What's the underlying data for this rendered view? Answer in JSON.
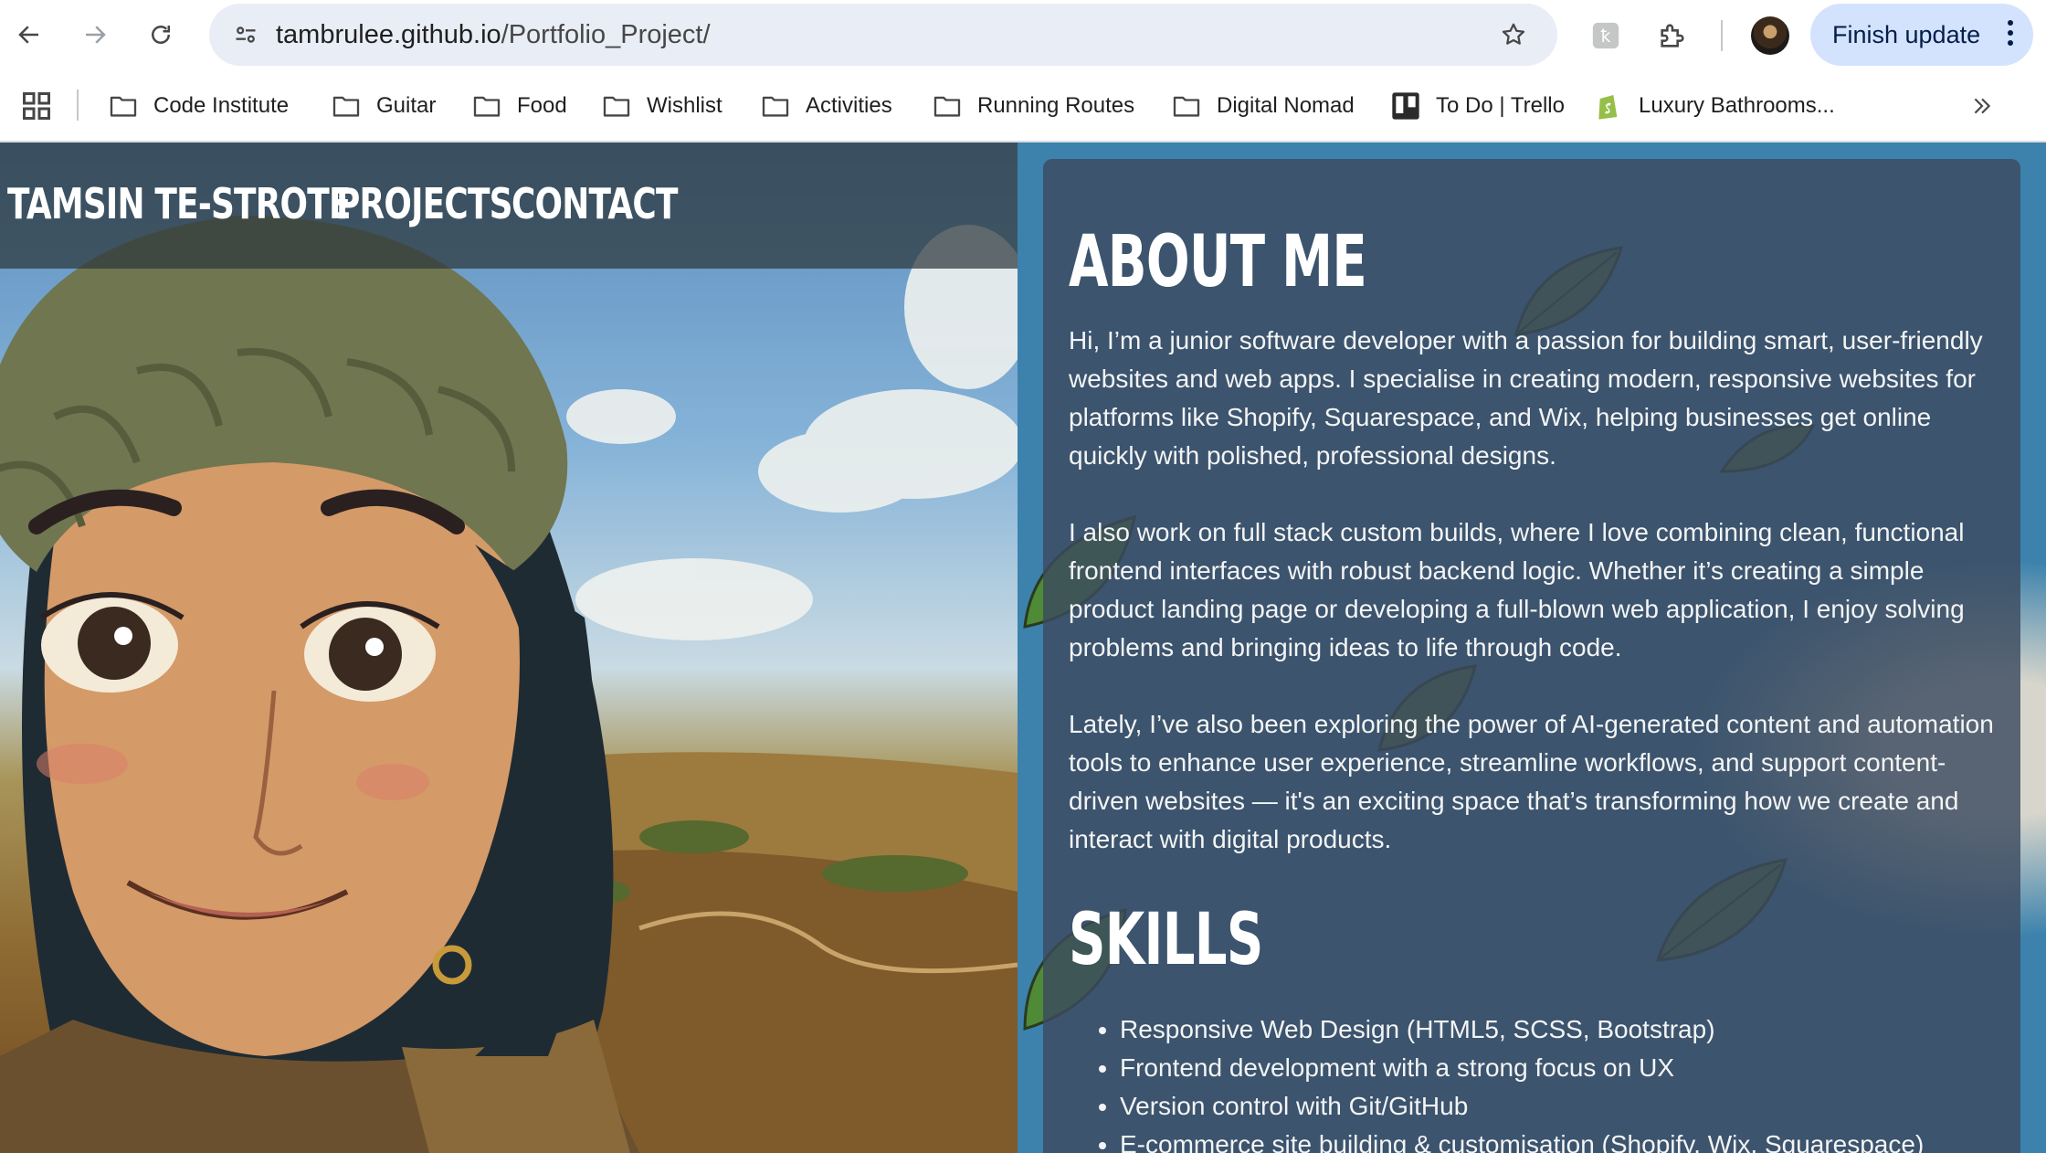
{
  "browser": {
    "url_host": "tambrulee.github.io",
    "url_path": "/Portfolio_Project/",
    "finish_update_label": "Finish update",
    "bookmarks": [
      {
        "label": "Code Institute",
        "icon": "folder-icon"
      },
      {
        "label": "Guitar",
        "icon": "folder-icon"
      },
      {
        "label": "Food",
        "icon": "folder-icon"
      },
      {
        "label": "Wishlist",
        "icon": "folder-icon"
      },
      {
        "label": "Activities",
        "icon": "folder-icon"
      },
      {
        "label": "Running Routes",
        "icon": "folder-icon"
      },
      {
        "label": "Digital Nomad",
        "icon": "folder-icon"
      },
      {
        "label": "To Do | Trello",
        "icon": "trello-icon"
      },
      {
        "label": "Luxury Bathrooms...",
        "icon": "shopify-icon"
      }
    ]
  },
  "site": {
    "nav": {
      "brand": "TAMSIN TE-STROTE",
      "projects": "PROJECTS",
      "contact": "CONTACT"
    },
    "about": {
      "heading": "ABOUT ME",
      "paragraphs": [
        "Hi, I’m a junior software developer with a passion for building smart, user-friendly websites and web apps. I specialise in creating modern, responsive websites for platforms like Shopify, Squarespace, and Wix, helping businesses get online quickly with polished, professional designs.",
        "I also work on full stack custom builds, where I love combining clean, functional frontend interfaces with robust backend logic. Whether it’s creating a simple product landing page or developing a full-blown web application, I enjoy solving problems and bringing ideas to life through code.",
        "Lately, I’ve also been exploring the power of AI-generated content and automation tools to enhance user experience, streamline workflows, and support content-driven websites — it's an exciting space that’s transforming how we create and interact with digital products."
      ]
    },
    "skills": {
      "heading": "SKILLS",
      "items": [
        "Responsive Web Design (HTML5, SCSS, Bootstrap)",
        "Frontend development with a strong focus on UX",
        "Version control with Git/GitHub",
        "E-commerce site building & customisation (Shopify, Wix, Squarespace)"
      ]
    }
  },
  "colors": {
    "panel": "#3c4b5f",
    "page_bg": "#3c82ad",
    "finish_update_bg": "#d3e3fd"
  }
}
